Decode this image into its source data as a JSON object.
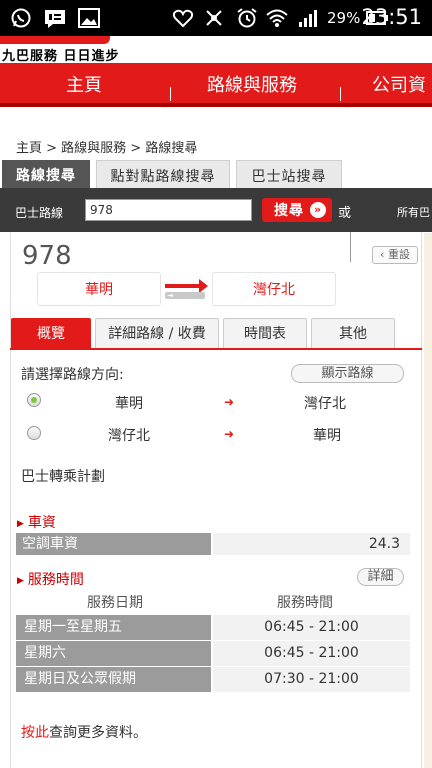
{
  "status_bar": {
    "battery_percent": "29%",
    "time": "23:51"
  },
  "logo": {
    "text": "九巴服務 日日進步"
  },
  "nav": {
    "items": [
      "主頁",
      "路線與服務",
      "公司資"
    ]
  },
  "breadcrumb": "主頁 > 路線與服務 > 路線搜尋",
  "search_tabs": [
    "路線搜尋",
    "點對點路線搜尋",
    "巴士站搜尋"
  ],
  "search": {
    "label": "巴士路線",
    "value": "978",
    "button": "搜尋",
    "or": "或",
    "all_routes": "所有巴"
  },
  "route": {
    "number": "978",
    "reset": "重設",
    "from": "華明",
    "to": "灣仔北"
  },
  "sub_tabs": [
    "概覽",
    "詳細路線 / 收費",
    "時間表",
    "其他"
  ],
  "direction": {
    "label": "請選擇路線方向:",
    "show_route": "顯示路線",
    "options": [
      {
        "from": "華明",
        "to": "灣仔北",
        "selected": true
      },
      {
        "from": "灣仔北",
        "to": "華明",
        "selected": false
      }
    ]
  },
  "transfer": "巴士轉乘計劃",
  "fare": {
    "title": "車資",
    "label": "空調車資",
    "value": "24.3"
  },
  "hours": {
    "title": "服務時間",
    "detail": "詳細",
    "col_day": "服務日期",
    "col_time": "服務時間",
    "rows": [
      {
        "day": "星期一至星期五",
        "time": "06:45 - 21:00"
      },
      {
        "day": "星期六",
        "time": "06:45 - 21:00"
      },
      {
        "day": "星期日及公眾假期",
        "time": "07:30 - 21:00"
      }
    ]
  },
  "more_info": {
    "link": "按此",
    "text": "查詢更多資料。"
  },
  "colors": {
    "brand_red": "#e21a1a",
    "dark_bar": "#3a3a3a",
    "label_gray": "#9b9b9b"
  }
}
